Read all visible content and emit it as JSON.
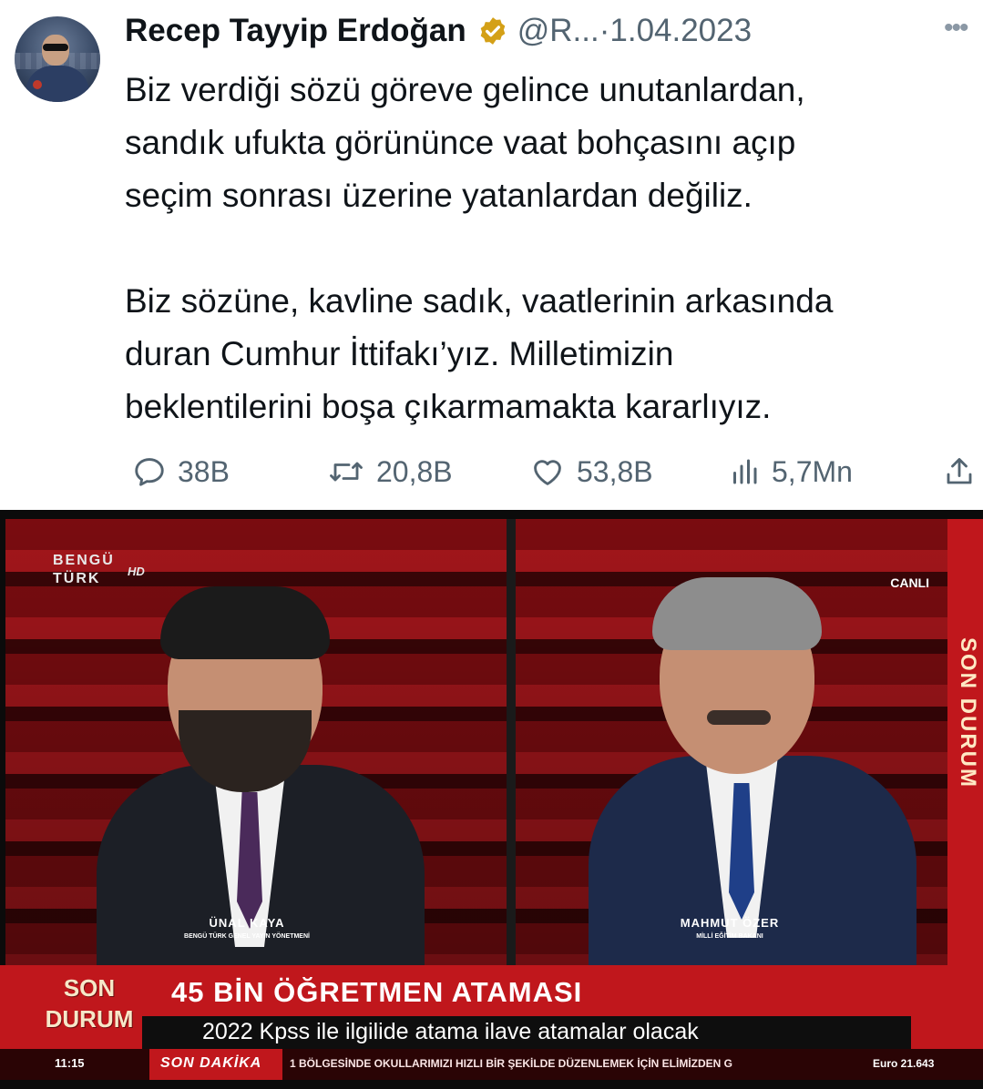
{
  "tweet": {
    "author_name": "Recep Tayyip Erdoğan",
    "handle": "@R...",
    "separator": "·",
    "date": "1.04.2023",
    "paragraphs": [
      "Biz verdiği sözü göreve gelince unutanlardan,\nsandık ufukta görününce vaat bohçasını açıp\nseçim sonrası üzerine yatanlardan değiliz.",
      "Biz sözüne, kavline sadık, vaatlerinin arkasında\nduran Cumhur İttifakı’yız. Milletimizin\nbeklentilerini boşa çıkarmamakta kararlıyız."
    ],
    "stats": {
      "replies": "38B",
      "retweets": "20,8B",
      "likes": "53,8B",
      "views": "5,7Mn"
    }
  },
  "tv": {
    "channel": {
      "line1": "BENGÜ",
      "line2": "TÜRK",
      "hd": "HD"
    },
    "live_label": "CANLI",
    "side_banner": "SON DURUM",
    "guest_left": {
      "name": "ÜNAL KAYA",
      "title": "BENGÜ TÜRK GENEL YAYIN YÖNETMENİ"
    },
    "guest_right": {
      "name": "MAHMUT ÖZER",
      "title": "MİLLİ EĞİTİM BAKANI"
    },
    "badge": {
      "line1": "SON",
      "line2": "DURUM"
    },
    "headline": "45 BİN ÖĞRETMEN ATAMASI",
    "subline": "2022 Kpss ile ilgilide atama ilave atamalar olacak",
    "clock": "11:15",
    "ticker_label": "SON DAKİKA",
    "ticker_text": "1 BÖLGESİNDE OKULLARIMIZI HIZLI BİR ŞEKİLDE DÜZENLEMEK İÇİN ELİMİZDEN G",
    "euro": "Euro  21.643"
  },
  "colors": {
    "verified_gold": "#d4a017",
    "text_secondary": "#536471",
    "tv_red": "#c0171c"
  },
  "icons": [
    "verified-badge-icon",
    "more-icon",
    "reply-icon",
    "retweet-icon",
    "like-icon",
    "views-icon",
    "share-icon"
  ]
}
